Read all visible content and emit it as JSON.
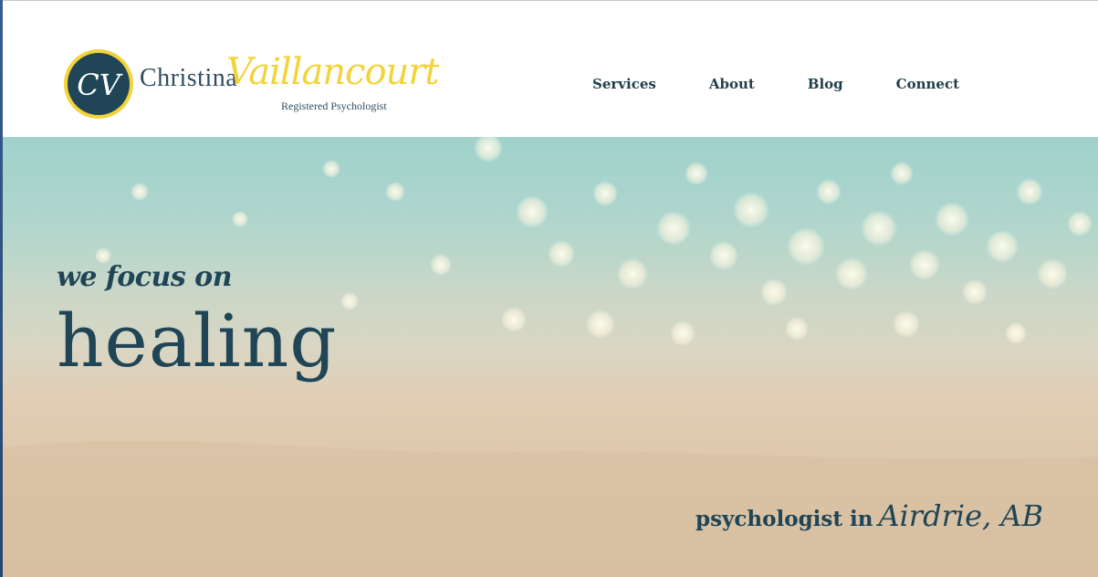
{
  "brand": {
    "monogram": "CV",
    "first_name": "Christina",
    "last_name": "Vaillancourt",
    "subtitle": "Registered Psychologist",
    "colors": {
      "navy": "#1f4556",
      "yellow": "#f2d33a"
    }
  },
  "nav": {
    "items": [
      {
        "label": "Services"
      },
      {
        "label": "About"
      },
      {
        "label": "Blog"
      },
      {
        "label": "Connect"
      }
    ]
  },
  "hero": {
    "lead": "we focus on",
    "headline": "healing",
    "tagline_prefix": "psychologist in",
    "tagline_location": "Airdrie, AB",
    "background": "beach-sand-ocean-bokeh"
  }
}
